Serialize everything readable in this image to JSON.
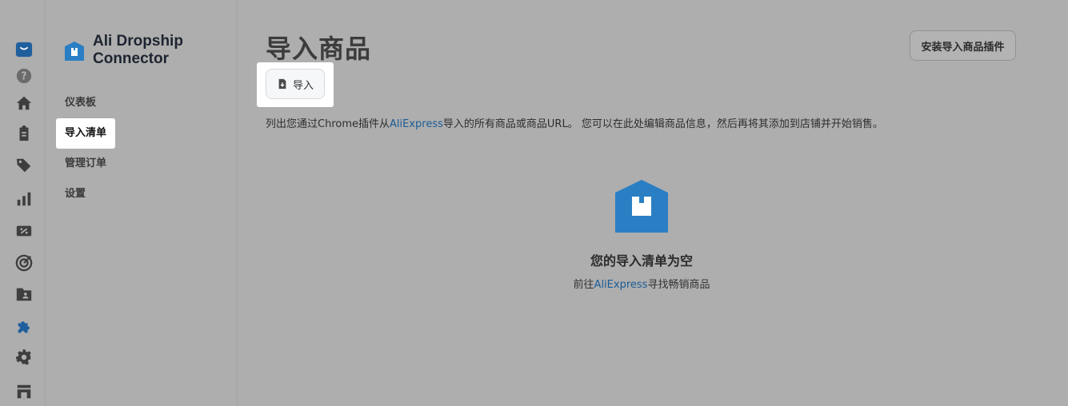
{
  "app": {
    "brand_name": "Ali Dropship Connector"
  },
  "rail": [
    {
      "icon": "store-logo-icon"
    },
    {
      "icon": "help-icon"
    },
    {
      "icon": "home-icon"
    },
    {
      "icon": "orders-clipboard-icon"
    },
    {
      "icon": "tags-icon"
    },
    {
      "icon": "analytics-icon"
    },
    {
      "icon": "discount-icon"
    },
    {
      "icon": "marketing-target-icon"
    },
    {
      "icon": "customers-folder-icon"
    },
    {
      "icon": "apps-puzzle-icon"
    },
    {
      "icon": "settings-gear-icon"
    },
    {
      "icon": "online-store-icon"
    }
  ],
  "sidebar": {
    "items": [
      {
        "label": "仪表板"
      },
      {
        "label": "导入清单"
      },
      {
        "label": "管理订单"
      },
      {
        "label": "设置"
      }
    ]
  },
  "main": {
    "title": "导入商品",
    "install_button": "安装导入商品插件",
    "import_button": "导入",
    "desc_before": "列出您通过Chrome插件从",
    "desc_link": "AliExpress",
    "desc_after": "导入的所有商品或商品URL。 您可以在此处编辑商品信息，然后再将其添加到店铺并开始销售。",
    "empty_title": "您的导入清单为空",
    "empty_before": "前往",
    "empty_link": "AliExpress",
    "empty_after": "寻找畅销商品"
  },
  "colors": {
    "overlay_bg": "#aeaeae",
    "link": "#1b5c96",
    "brand_blue": "#2a7fc4"
  }
}
